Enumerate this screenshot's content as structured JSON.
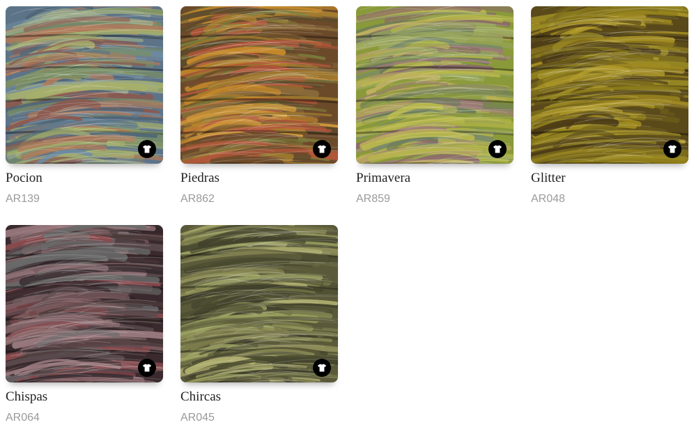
{
  "products": [
    {
      "name": "Pocion",
      "code": "AR139",
      "icon": "shirt-icon",
      "colors": [
        "#5d7488",
        "#7a8f63",
        "#a6b06a",
        "#8a5a50",
        "#6e8aa0",
        "#4f6578",
        "#9aa98a",
        "#b07a5a"
      ]
    },
    {
      "name": "Piedras",
      "code": "AR862",
      "icon": "shirt-icon",
      "colors": [
        "#6b4a2a",
        "#a07a2e",
        "#c88a2a",
        "#8a6a3a",
        "#b2563a",
        "#7a7a3a",
        "#d09a3a",
        "#5a4a2a"
      ]
    },
    {
      "name": "Primavera",
      "code": "AR859",
      "icon": "shirt-icon",
      "colors": [
        "#8a9a3a",
        "#b8b84a",
        "#7a8a6a",
        "#a07a7a",
        "#9aa860",
        "#6a7a5a",
        "#c0b060",
        "#8a6a6a"
      ]
    },
    {
      "name": "Glitter",
      "code": "AR048",
      "icon": "shirt-icon",
      "colors": [
        "#5a4a1a",
        "#8a7a1a",
        "#a08a20",
        "#6a5a1a",
        "#b09a2a",
        "#4a3a16",
        "#9a8a24",
        "#7a6a1c"
      ]
    },
    {
      "name": "Chispas",
      "code": "AR064",
      "icon": "shirt-icon",
      "colors": [
        "#3a2a2e",
        "#5a4a4e",
        "#7a5a5e",
        "#4a3a3a",
        "#8a4a4e",
        "#6a6a6a",
        "#2e2428",
        "#9a7a7e"
      ]
    },
    {
      "name": "Chircas",
      "code": "AR045",
      "icon": "shirt-icon",
      "colors": [
        "#5a5a3a",
        "#7a7a4a",
        "#9aa060",
        "#4a4a30",
        "#b0b070",
        "#6a6a44",
        "#3e3e2a",
        "#8a8a56"
      ]
    }
  ]
}
